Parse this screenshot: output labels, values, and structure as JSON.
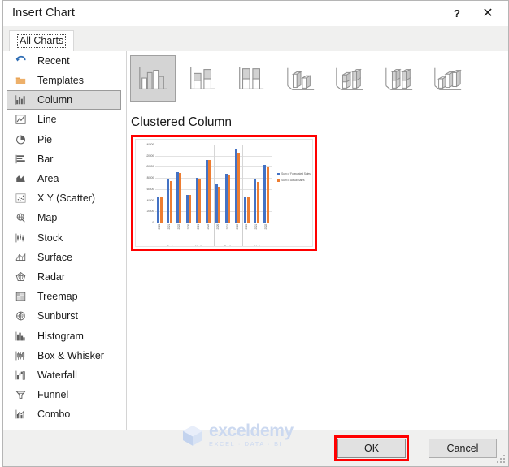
{
  "window": {
    "title": "Insert Chart",
    "help_icon": "question-mark-icon",
    "close_icon": "close-icon"
  },
  "tabs": [
    {
      "label": "All Charts",
      "selected": true
    }
  ],
  "sidebar": {
    "items": [
      {
        "label": "Recent",
        "icon": "recent-undo-icon",
        "selected": false
      },
      {
        "label": "Templates",
        "icon": "folder-icon",
        "selected": false
      },
      {
        "label": "Column",
        "icon": "column-chart-icon",
        "selected": true
      },
      {
        "label": "Line",
        "icon": "line-chart-icon",
        "selected": false
      },
      {
        "label": "Pie",
        "icon": "pie-chart-icon",
        "selected": false
      },
      {
        "label": "Bar",
        "icon": "bar-chart-icon",
        "selected": false
      },
      {
        "label": "Area",
        "icon": "area-chart-icon",
        "selected": false
      },
      {
        "label": "X Y (Scatter)",
        "icon": "scatter-chart-icon",
        "selected": false
      },
      {
        "label": "Map",
        "icon": "map-globe-icon",
        "selected": false
      },
      {
        "label": "Stock",
        "icon": "stock-chart-icon",
        "selected": false
      },
      {
        "label": "Surface",
        "icon": "surface-chart-icon",
        "selected": false
      },
      {
        "label": "Radar",
        "icon": "radar-chart-icon",
        "selected": false
      },
      {
        "label": "Treemap",
        "icon": "treemap-chart-icon",
        "selected": false
      },
      {
        "label": "Sunburst",
        "icon": "sunburst-chart-icon",
        "selected": false
      },
      {
        "label": "Histogram",
        "icon": "histogram-chart-icon",
        "selected": false
      },
      {
        "label": "Box & Whisker",
        "icon": "boxwhisker-chart-icon",
        "selected": false
      },
      {
        "label": "Waterfall",
        "icon": "waterfall-chart-icon",
        "selected": false
      },
      {
        "label": "Funnel",
        "icon": "funnel-chart-icon",
        "selected": false
      },
      {
        "label": "Combo",
        "icon": "combo-chart-icon",
        "selected": false
      }
    ]
  },
  "chart_types": [
    {
      "name": "Clustered Column",
      "icon": "clustered-column-icon",
      "selected": true
    },
    {
      "name": "Stacked Column",
      "icon": "stacked-column-icon",
      "selected": false
    },
    {
      "name": "100% Stacked Column",
      "icon": "stacked-column-100-icon",
      "selected": false
    },
    {
      "name": "3-D Clustered Column",
      "icon": "clustered-column-3d-icon",
      "selected": false
    },
    {
      "name": "3-D Stacked Column",
      "icon": "stacked-column-3d-icon",
      "selected": false
    },
    {
      "name": "3-D 100% Stacked Column",
      "icon": "stacked-column-100-3d-icon",
      "selected": false
    },
    {
      "name": "3-D Column",
      "icon": "column-3d-icon",
      "selected": false
    }
  ],
  "preview": {
    "title": "Clustered Column",
    "highlight_color": "#ff0000"
  },
  "chart_data": {
    "type": "bar",
    "title": "",
    "xlabel": "",
    "ylabel": "",
    "ylim": [
      0,
      140000
    ],
    "yticks": [
      0,
      20000,
      40000,
      60000,
      80000,
      100000,
      120000,
      140000
    ],
    "ytick_labels": [
      "0",
      "20000",
      "40000",
      "60000",
      "80000",
      "100000",
      "120000",
      "140000"
    ],
    "grid": true,
    "legend_position": "right",
    "groups": [
      "East",
      "North",
      "South",
      "West"
    ],
    "categories": [
      "2020",
      "2021",
      "2022",
      "2020",
      "2021",
      "2022",
      "2020",
      "2021",
      "2022",
      "2020",
      "2021",
      "2022"
    ],
    "series": [
      {
        "name": "Sum of Forecasted Sales",
        "color": "#4472c4",
        "values": [
          45000,
          79000,
          90000,
          50000,
          80000,
          113000,
          69000,
          87000,
          133000,
          47000,
          79000,
          104000
        ]
      },
      {
        "name": "Sum of Actual Sales",
        "color": "#ed7d31",
        "values": [
          45000,
          74000,
          89000,
          49000,
          77000,
          112000,
          64000,
          85000,
          125000,
          47000,
          73000,
          99000
        ]
      }
    ]
  },
  "footer": {
    "ok_label": "OK",
    "cancel_label": "Cancel"
  },
  "watermark": {
    "name": "exceldemy",
    "tagline": "EXCEL · DATA · BI"
  }
}
